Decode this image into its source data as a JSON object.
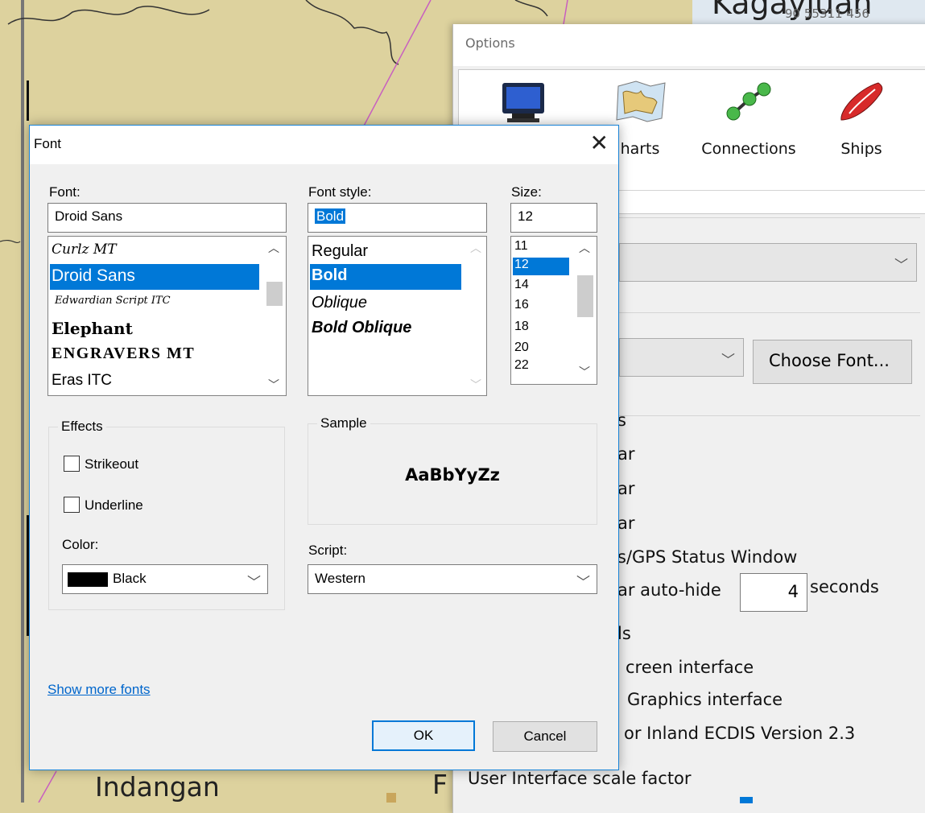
{
  "map": {
    "labels": {
      "top_right": "Kagayjuan",
      "top_right_small": "90 55311 456",
      "bottom": "Indangan",
      "bottom_right": "F"
    }
  },
  "options_window": {
    "title": "Options",
    "toolbar": [
      {
        "label": "",
        "icon": "display-icon"
      },
      {
        "label": "Charts",
        "visible_label": "harts",
        "icon": "charts-icon"
      },
      {
        "label": "Connections",
        "icon": "connections-icon"
      },
      {
        "label": "Ships",
        "icon": "ship-icon"
      }
    ],
    "choose_font_button": "Choose Font...",
    "partial_texts": {
      "s1": "s",
      "ar1": "ar",
      "ar2": "ar",
      "ar3": "ar",
      "gps": "s/GPS Status Window",
      "autohide": "ar auto-hide",
      "autohide_value": "4",
      "seconds": "seconds",
      "ls": "ls",
      "screen": "creen interface",
      "graphics": "Graphics interface",
      "inland": "or Inland ECDIS Version 2.3",
      "scale": "User Interface scale factor"
    }
  },
  "font_dialog": {
    "title": "Font",
    "close_symbol": "✕",
    "font_label": "Font:",
    "font_value": "Droid Sans",
    "font_list": [
      "Curlz MT",
      "Droid Sans",
      "Edwardian Script ITC",
      "Elephant",
      "ENGRAVERS MT",
      "Eras ITC"
    ],
    "font_selected_index": 1,
    "style_label": "Font style:",
    "style_value": "Bold",
    "style_list": [
      "Regular",
      "Bold",
      "Oblique",
      "Bold Oblique"
    ],
    "style_selected_index": 1,
    "size_label": "Size:",
    "size_value": "12",
    "size_list": [
      "11",
      "12",
      "14",
      "16",
      "18",
      "20",
      "22"
    ],
    "size_selected_index": 1,
    "effects_label": "Effects",
    "strikeout_label": "Strikeout",
    "underline_label": "Underline",
    "strikeout_checked": false,
    "underline_checked": false,
    "color_label": "Color:",
    "color_value": "Black",
    "color_swatch": "#000000",
    "sample_label": "Sample",
    "sample_text": "AaBbYyZz",
    "script_label": "Script:",
    "script_value": "Western",
    "show_more_fonts": "Show more fonts",
    "ok_button": "OK",
    "cancel_button": "Cancel"
  },
  "colors": {
    "accent": "#0078d7",
    "map_land": "#ddd29e",
    "map_line": "#c85fc0"
  }
}
